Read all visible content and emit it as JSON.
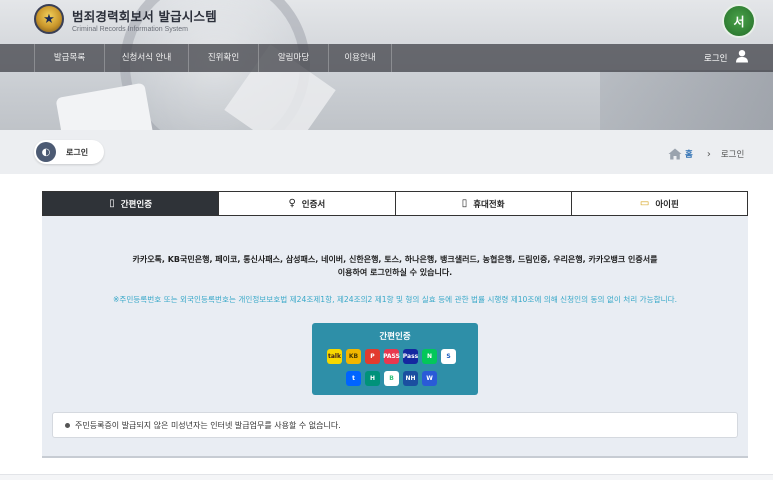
{
  "header": {
    "title": "범죄경력회보서 발급시스템",
    "subtitle": "Criminal Records Information System",
    "gov_badge": "서",
    "nav": [
      "발급목록",
      "신청서식 안내",
      "진위확인",
      "알림마당",
      "이용안내"
    ],
    "login_label": "로그인"
  },
  "page": {
    "pill_label": "로그인",
    "breadcrumb_home": "홈",
    "breadcrumb_sep": "›",
    "breadcrumb_current": "로그인"
  },
  "tabs": [
    {
      "label": "간편인증",
      "icon": "mobile-icon",
      "active": true
    },
    {
      "label": "인증서",
      "icon": "certificate-icon",
      "active": false
    },
    {
      "label": "휴대전화",
      "icon": "phone-icon",
      "active": false
    },
    {
      "label": "아이핀",
      "icon": "ipin-icon",
      "active": false
    }
  ],
  "content": {
    "desc_line1": "카카오톡, KB국민은행, 페이코, 통신사패스, 삼성패스, 네이버, 신한은행, 토스, 하나은행, 뱅크샐러드, 농협은행, 드림인증, 우리은행, 카카오뱅크 인증서를",
    "desc_line2": "이용하여 로그인하실 수 있습니다.",
    "notice": "※주민등록번호 또는 외국인등록번호는 개인정보보호법 제24조제1항, 제24조의2 제1항 및 형의 실효 등에 관한 법률 시행령 제10조에 의해 신청인의 동의 없이 처리 가능합니다.",
    "easy_auth_title": "간편인증",
    "info": "주민등록증이 발급되지 않은 미성년자는 인터넷 발급업무를 사용할 수 없습니다."
  },
  "colors": {
    "nav_bg": "#46484e",
    "tab_active": "#2f3338",
    "panel_bg": "#e9edf3",
    "easy_box": "#2e8fa8",
    "notice_text": "#38a8c8",
    "home_link": "#2d6fb3"
  }
}
